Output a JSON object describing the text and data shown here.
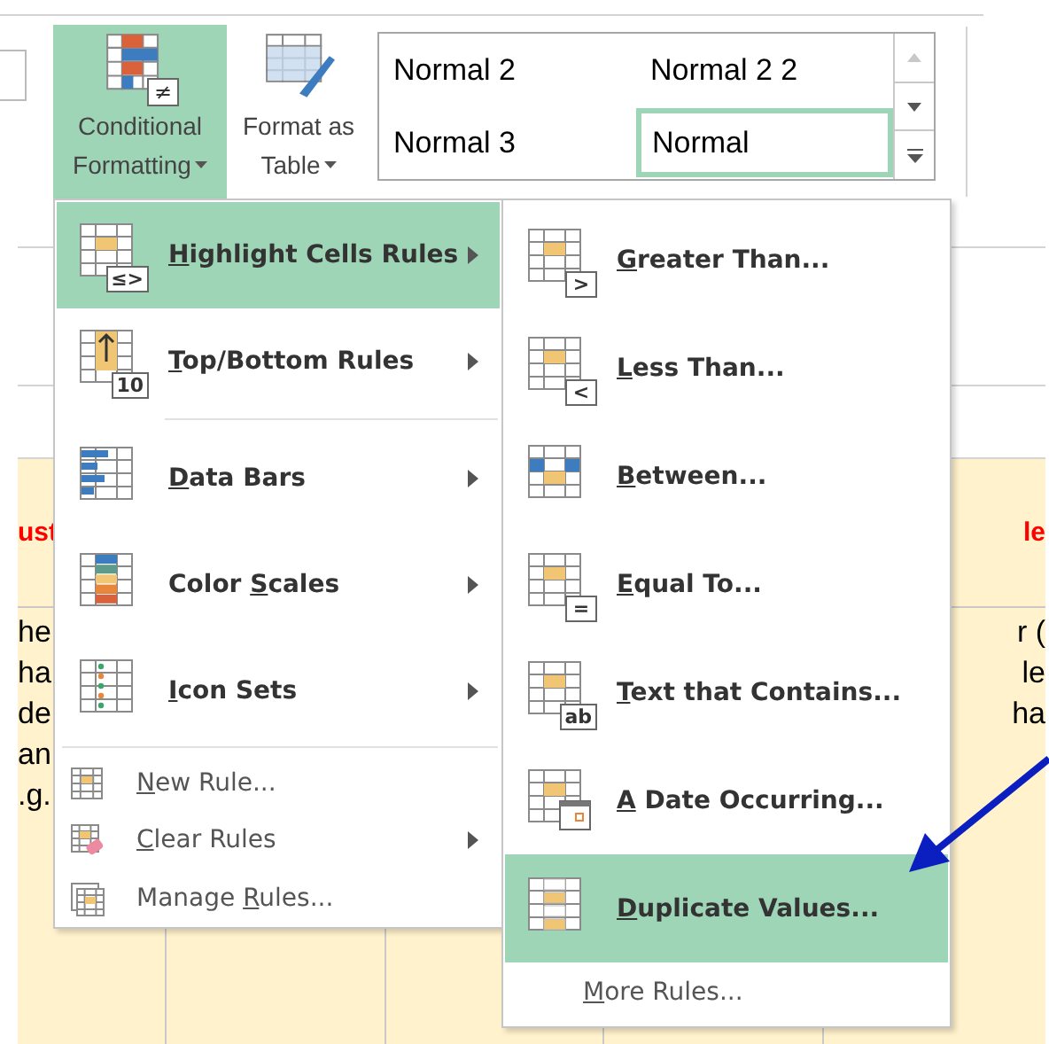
{
  "ribbon": {
    "buttons": [
      {
        "label_lines": [
          "Conditional",
          "Formatting"
        ],
        "badge": "≠",
        "dropdown": true,
        "selected": true
      },
      {
        "label_lines": [
          "Format as",
          "Table"
        ],
        "dropdown": true,
        "selected": false
      }
    ],
    "styles": [
      {
        "label": "Normal 2",
        "selected": false
      },
      {
        "label": "Normal 2 2",
        "selected": false
      },
      {
        "label": "Normal 3",
        "selected": false
      },
      {
        "label": "Normal",
        "selected": true
      }
    ],
    "scroll_buttons": [
      {
        "kind": "up",
        "disabled": true
      },
      {
        "kind": "down",
        "disabled": false
      },
      {
        "kind": "more",
        "disabled": false
      }
    ]
  },
  "sheet": {
    "left_column": {
      "header": "ust",
      "lines": [
        "he",
        "ha",
        "de",
        "an",
        ".g."
      ]
    },
    "right_column": {
      "header": "le",
      "lines": [
        "r (",
        "le",
        "ha"
      ]
    }
  },
  "menu": {
    "items": [
      {
        "kind": "large",
        "label": {
          "key": "H",
          "post": "ighlight Cells Rules"
        },
        "badge": "≤>",
        "submenu": true,
        "selected": true,
        "divider_above": false
      },
      {
        "kind": "large",
        "label": {
          "key": "T",
          "post": "op/Bottom Rules"
        },
        "badge": "10",
        "submenu": true,
        "selected": false,
        "divider_above": false
      },
      {
        "kind": "large",
        "label": {
          "key": "D",
          "post": "ata Bars"
        },
        "submenu": true,
        "selected": false,
        "divider_above": true
      },
      {
        "kind": "large",
        "label": {
          "pre": "Color ",
          "key": "S",
          "post": "cales"
        },
        "submenu": true,
        "selected": false,
        "divider_above": false
      },
      {
        "kind": "large",
        "label": {
          "key": "I",
          "post": "con Sets"
        },
        "submenu": true,
        "selected": false,
        "divider_above": false
      },
      {
        "kind": "small",
        "label": {
          "key": "N",
          "post": "ew Rule..."
        },
        "submenu": false,
        "selected": false,
        "divider_above": true
      },
      {
        "kind": "small",
        "label": {
          "key": "C",
          "post": "lear Rules"
        },
        "submenu": true,
        "selected": false,
        "divider_above": false
      },
      {
        "kind": "small",
        "label": {
          "pre": "Manage ",
          "key": "R",
          "post": "ules..."
        },
        "submenu": false,
        "selected": false,
        "divider_above": false
      }
    ]
  },
  "submenu": {
    "items": [
      {
        "kind": "large",
        "label": {
          "key": "G",
          "post": "reater Than..."
        },
        "badge": ">",
        "selected": false
      },
      {
        "kind": "large",
        "label": {
          "key": "L",
          "post": "ess Than..."
        },
        "badge": "<",
        "selected": false
      },
      {
        "kind": "large",
        "label": {
          "key": "B",
          "post": "etween..."
        },
        "selected": false
      },
      {
        "kind": "large",
        "label": {
          "key": "E",
          "post": "qual To..."
        },
        "badge": "=",
        "selected": false
      },
      {
        "kind": "large",
        "label": {
          "key": "T",
          "post": "ext that Contains..."
        },
        "badge": "ab",
        "selected": false
      },
      {
        "kind": "large",
        "label": {
          "key": "A",
          "post": " Date Occurring..."
        },
        "selected": false
      },
      {
        "kind": "large",
        "label": {
          "key": "D",
          "post": "uplicate Values..."
        },
        "selected": true
      },
      {
        "kind": "text",
        "label": {
          "key": "M",
          "post": "ore Rules..."
        },
        "selected": false
      }
    ]
  }
}
